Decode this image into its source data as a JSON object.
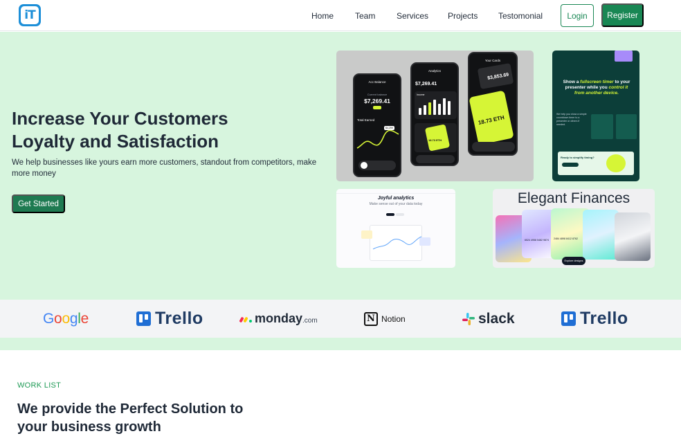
{
  "brand": {
    "logo_text": "iT"
  },
  "nav": {
    "links": [
      "Home",
      "Team",
      "Services",
      "Projects",
      "Testomonial"
    ],
    "login": "Login",
    "register": "Register"
  },
  "hero": {
    "title_line1": "Increase Your Customers",
    "title_line2": "Loyalty and Satisfaction",
    "subtitle": "We help businesses like yours earn more customers, standout from competitors, make more money",
    "cta": "Get Started"
  },
  "gallery": {
    "phones": {
      "p1_title": "Acc Balance",
      "p1_label": "Current balance",
      "p1_value": "$7,269.41",
      "p1_earned": "Total Earned",
      "p1_tag": "$4,299",
      "p2_title": "Analytics",
      "p2_value": "$7,269.41",
      "p2_income": "Income",
      "p2_card": "18.73 ETH",
      "p3_title": "Your Cards",
      "p3_value": "$3,853.69",
      "p3_eth": "18.73 ETH"
    },
    "dark": {
      "headline_a": "Show a",
      "headline_b": "fullscreen timer",
      "headline_c": "to your presenter while you",
      "headline_d": "control it",
      "headline_e": "from another device.",
      "body": "We help you show a simple countdown timer to a presenter or others if needed.",
      "cta": "Ready to simplify timing?"
    },
    "analytics": {
      "title": "Joyful analytics",
      "subtitle": "Make sense out of your data today"
    },
    "finance": {
      "title": "Elegant Finances",
      "card_no1": "6524 4958 5482 9874",
      "card_no2": "2484 4898 8412 8762",
      "cta": "Explore designs"
    }
  },
  "partners": {
    "google": "Google",
    "trello": "Trello",
    "monday": "monday",
    "monday_suffix": ".com",
    "notion": "Notion",
    "slack": "slack",
    "trello2": "Trello"
  },
  "worklist": {
    "eyebrow": "WORK LIST",
    "title_line1": "We provide the Perfect Solution to",
    "title_line2": "your business growth"
  }
}
